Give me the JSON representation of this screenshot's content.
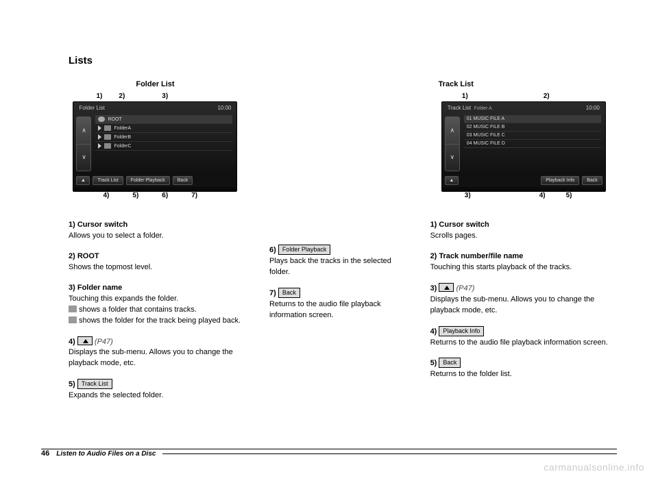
{
  "section_title": "Lists",
  "folder_list": {
    "caption": "Folder List",
    "header_title": "Folder List",
    "header_time": "10:00",
    "rows": [
      "ROOT",
      "FolderA",
      "FolderB",
      "FolderC"
    ],
    "footer": {
      "tracklist": "Track List",
      "folderplay": "Folder Playback",
      "back": "Back"
    },
    "callouts_top": [
      "1)",
      "2)",
      "3)"
    ],
    "callouts_bottom": [
      "4)",
      "5)",
      "6)",
      "7)"
    ]
  },
  "track_list": {
    "caption": "Track List",
    "header_title": "Track List",
    "header_sub": "Folder A",
    "header_time": "10:00",
    "rows": [
      "01 MUSIC FILE  A",
      "02 MUSIC FILE  B",
      "03 MUSIC FILE  C",
      "04 MUSIC FILE  D"
    ],
    "footer": {
      "playbackinfo": "Playback Info",
      "back": "Back"
    },
    "callouts_top": [
      "1)",
      "2)"
    ],
    "callouts_bottom": [
      "3)",
      "4)",
      "5)"
    ]
  },
  "left_items": [
    {
      "num": "1)",
      "title": "Cursor switch",
      "body": "Allows you to select a folder."
    },
    {
      "num": "2)",
      "title": "ROOT",
      "body": "Shows the topmost level."
    },
    {
      "num": "3)",
      "title": "Folder name",
      "body": "Touching this expands the folder.",
      "extra1": "shows a folder that contains tracks.",
      "extra2": "shows the folder for the track being played back."
    },
    {
      "num": "4)",
      "btn": "tri",
      "ref": "(P47)",
      "body": "Displays the sub-menu. Allows you to change the playback mode, etc."
    },
    {
      "num": "5)",
      "btn_label": "Track List",
      "body": "Expands the selected folder."
    }
  ],
  "mid_items": [
    {
      "num": "6)",
      "btn_label": "Folder Playback",
      "body": "Plays back the tracks in the selected folder."
    },
    {
      "num": "7)",
      "btn_label": "Back",
      "body": "Returns to the audio file playback information screen."
    }
  ],
  "right_items": [
    {
      "num": "1)",
      "title": "Cursor switch",
      "body": "Scrolls pages."
    },
    {
      "num": "2)",
      "title": "Track number/file name",
      "body": "Touching this starts playback of the tracks."
    },
    {
      "num": "3)",
      "btn": "tri",
      "ref": "(P47)",
      "body": "Displays the sub-menu. Allows you to change the playback mode, etc."
    },
    {
      "num": "4)",
      "btn_label": "Playback Info",
      "body": "Returns to the audio file playback information screen."
    },
    {
      "num": "5)",
      "btn_label": "Back",
      "body": "Returns to the folder list."
    }
  ],
  "footer": {
    "page": "46",
    "title": "Listen to Audio Files on a Disc"
  },
  "watermark": "carmanualsonline.info"
}
